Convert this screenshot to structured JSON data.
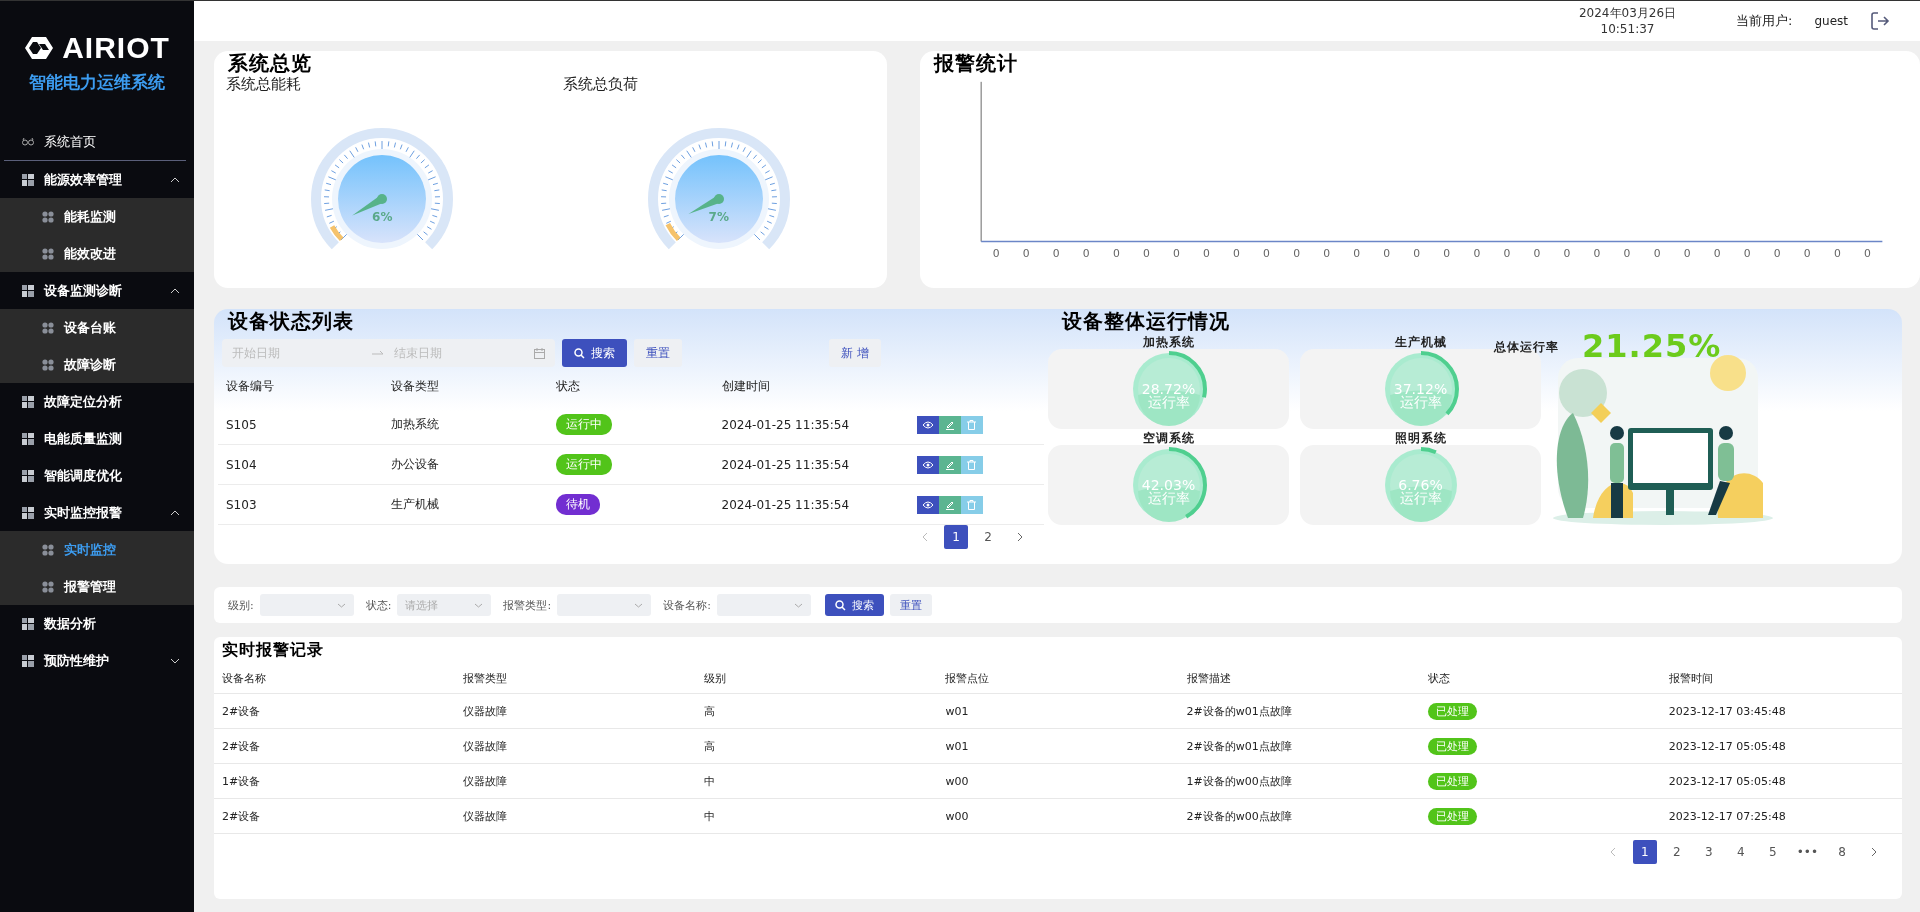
{
  "sidebar": {
    "logo": "AIRIOT",
    "subtitle": "智能电力运维系统",
    "items": [
      {
        "kind": "home",
        "label": "系统首页",
        "selected": false
      },
      {
        "kind": "group",
        "label": "能源效率管理",
        "selected": false,
        "expanded": true,
        "children": [
          {
            "label": "能耗监测",
            "selected": false
          },
          {
            "label": "能效改进",
            "selected": false
          }
        ]
      },
      {
        "kind": "group",
        "label": "设备监测诊断",
        "selected": false,
        "expanded": true,
        "children": [
          {
            "label": "设备台账",
            "selected": false
          },
          {
            "label": "故障诊断",
            "selected": false
          }
        ]
      },
      {
        "kind": "link",
        "label": "故障定位分析",
        "selected": false
      },
      {
        "kind": "link",
        "label": "电能质量监测",
        "selected": false
      },
      {
        "kind": "link",
        "label": "智能调度优化",
        "selected": false
      },
      {
        "kind": "group",
        "label": "实时监控报警",
        "selected": false,
        "expanded": true,
        "children": [
          {
            "label": "实时监控",
            "selected": true
          },
          {
            "label": "报警管理",
            "selected": false
          }
        ]
      },
      {
        "kind": "link",
        "label": "数据分析",
        "selected": false
      },
      {
        "kind": "group",
        "label": "预防性维护",
        "selected": false,
        "expanded": false
      }
    ]
  },
  "header": {
    "date": "2024年03月26日",
    "time": "10:51:37",
    "user_label": "当前用户:",
    "user": "guest"
  },
  "overview": {
    "title": "系统总览",
    "gauges": [
      {
        "label": "系统总能耗",
        "level": 0.06,
        "reading": "6%"
      },
      {
        "label": "系统总负荷",
        "level": 0.07,
        "reading": "7%"
      }
    ]
  },
  "alarm_stats": {
    "title": "报警统计",
    "x_labels": [
      "0",
      "0",
      "0",
      "0",
      "0",
      "0",
      "0",
      "0",
      "0",
      "0",
      "0",
      "0",
      "0",
      "0",
      "0",
      "0",
      "0",
      "0",
      "0",
      "0",
      "0",
      "0",
      "0",
      "0",
      "0",
      "0",
      "0",
      "0",
      "0",
      "0"
    ]
  },
  "device_list": {
    "title": "设备状态列表",
    "start_placeholder": "开始日期",
    "end_placeholder": "结束日期",
    "search": "搜索",
    "reset": "重置",
    "add": "新 增",
    "columns": [
      "设备编号",
      "设备类型",
      "状态",
      "创建时间"
    ],
    "rows": [
      {
        "id": "S105",
        "type": "加热系统",
        "status": "运行中",
        "color": "#52c41a",
        "created": "2024-01-25 11:35:54"
      },
      {
        "id": "S104",
        "type": "办公设备",
        "status": "运行中",
        "color": "#52c41a",
        "created": "2024-01-25 11:35:54"
      },
      {
        "id": "S103",
        "type": "生产机械",
        "status": "待机",
        "color": "#722ed1",
        "created": "2024-01-25 11:35:54"
      }
    ],
    "pages": [
      {
        "label": "1",
        "selected": true
      },
      {
        "label": "2",
        "selected": false
      }
    ]
  },
  "run_status": {
    "title": "设备整体运行情况",
    "systems": [
      {
        "name": "加热系统",
        "level": 0.2872,
        "reading": "28.72%",
        "caption": "运行率"
      },
      {
        "name": "生产机械",
        "level": 0.3712,
        "reading": "37.12%",
        "caption": "运行率"
      },
      {
        "name": "空调系统",
        "level": 0.4203,
        "reading": "42.03%",
        "caption": "运行率"
      },
      {
        "name": "照明系统",
        "level": 0.0676,
        "reading": "6.76%",
        "caption": "运行率"
      }
    ],
    "overall_label": "总体运行率",
    "overall": "21.25%"
  },
  "filters": {
    "fields": [
      {
        "label": "级别:"
      },
      {
        "label": "状态:",
        "placeholder": "请选择"
      },
      {
        "label": "报警类型:"
      },
      {
        "label": "设备名称:"
      }
    ],
    "search": "搜索",
    "reset": "重置"
  },
  "alarm_records": {
    "title": "实时报警记录",
    "columns": [
      "设备名称",
      "报警类型",
      "级别",
      "报警点位",
      "报警描述",
      "状态",
      "报警时间"
    ],
    "rows": [
      [
        "2#设备",
        "仪器故障",
        "高",
        "w01",
        "2#设备的w01点故障",
        "已处理",
        "2023-12-17 03:45:48"
      ],
      [
        "2#设备",
        "仪器故障",
        "高",
        "w01",
        "2#设备的w01点故障",
        "已处理",
        "2023-12-17 05:05:48"
      ],
      [
        "1#设备",
        "仪器故障",
        "中",
        "w00",
        "1#设备的w00点故障",
        "已处理",
        "2023-12-17 05:05:48"
      ],
      [
        "2#设备",
        "仪器故障",
        "中",
        "w00",
        "2#设备的w00点故障",
        "已处理",
        "2023-12-17 07:25:48"
      ]
    ],
    "pages": [
      {
        "label": "1",
        "selected": true
      },
      {
        "label": "2",
        "selected": false
      },
      {
        "label": "3",
        "selected": false
      },
      {
        "label": "4",
        "selected": false
      },
      {
        "label": "5",
        "selected": false
      },
      {
        "label": "•••",
        "selected": false
      },
      {
        "label": "8",
        "selected": false
      }
    ]
  }
}
